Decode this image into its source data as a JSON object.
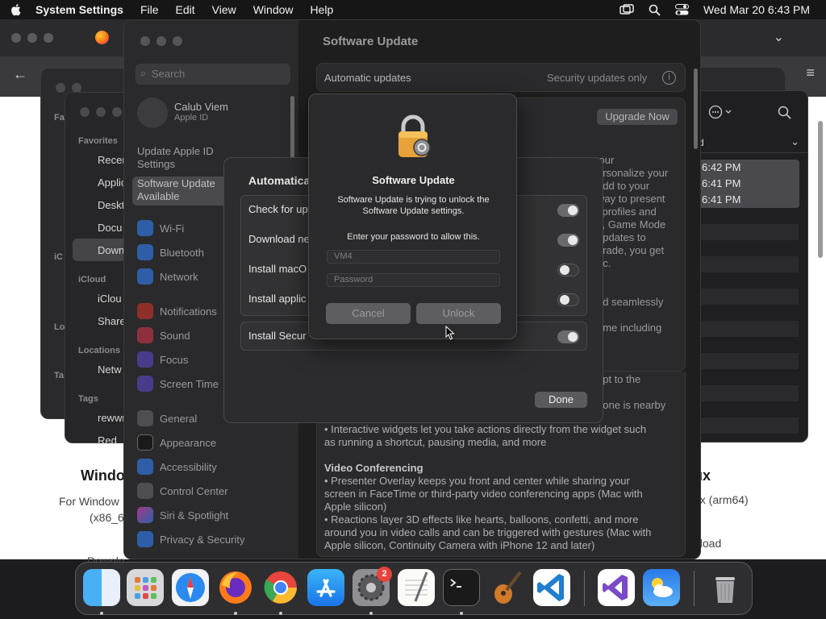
{
  "menubar": {
    "app_name": "System Settings",
    "menus": [
      "File",
      "Edit",
      "View",
      "Window",
      "Help"
    ],
    "clock": "Wed Mar 20  6:43 PM"
  },
  "browser": {
    "left_title": "Windo",
    "left_sub_1": "For Window",
    "left_sub_2": "(x86_6",
    "left_link": "Downlo",
    "right_title": "ux",
    "right_sub": "ux (arm64)",
    "right_link": "nload"
  },
  "finder": {
    "favorites_label": "Favorites",
    "icloud_label": "iCloud",
    "locations_label": "Locations",
    "tags_label": "Tags",
    "items": [
      "Recen",
      "Applic",
      "Deskt",
      "Docu",
      "Down",
      "iClou",
      "Share",
      "Netw",
      "rewwr",
      "Red"
    ],
    "clipped_labels": [
      "Fa",
      "iC",
      "Lo",
      "Ta"
    ]
  },
  "right_window": {
    "header_fragment": "d",
    "times": [
      "6:42 PM",
      "6:41 PM",
      "6:41 PM"
    ]
  },
  "settings": {
    "title": "Software Update",
    "search_placeholder": "Search",
    "user_name": "Calub Viem",
    "user_sub": "Apple ID",
    "update_apple_id_1": "Update Apple ID",
    "update_apple_id_2": "Settings",
    "selected_item_1": "Software Update",
    "selected_item_2": "Available",
    "sidebar_items": [
      "Wi-Fi",
      "Bluetooth",
      "Network",
      "Notifications",
      "Sound",
      "Focus",
      "Screen Time",
      "General",
      "Appearance",
      "Accessibility",
      "Control Center",
      "Siri & Spotlight",
      "Privacy & Security"
    ],
    "automatic_updates_label": "Automatic updates",
    "security_updates_label": "Security updates only",
    "upgrade_button": "Upgrade Now",
    "body_fragments": [
      "your",
      "ersonalize your",
      "add to your",
      "way to present",
      "i profiles and",
      "s, Game Mode",
      "updates to",
      "grade, you get",
      "ac.",
      "rld seamlessly",
      "eme including",
      "apt to the",
      "hone is nearby"
    ],
    "widgets_bullet_1": "• Interactive widgets let you take actions directly from the widget such",
    "widgets_bullet_2": "as running a shortcut, pausing media, and more",
    "video_heading": "Video Conferencing",
    "video_bullet_1": "• Presenter Overlay keeps you front and center while sharing your",
    "video_bullet_2": "screen in FaceTime or third-party video conferencing apps (Mac with",
    "video_bullet_3": "Apple silicon)",
    "video_bullet_4": "• Reactions layer 3D effects like hearts, balloons, confetti, and more",
    "video_bullet_5": "around you in video calls and can be triggered with gestures (Mac with",
    "video_bullet_6": "Apple silicon, Continuity Camera with iPhone 12 and later)"
  },
  "sheet": {
    "title": "Automatical",
    "rows": [
      {
        "label": "Check for up",
        "on": true
      },
      {
        "label": "Download ne",
        "on": true
      },
      {
        "label": "Install macO",
        "on": false
      },
      {
        "label": "Install applic",
        "on": false
      },
      {
        "label": "Install Secur",
        "on": true
      }
    ],
    "done_button": "Done"
  },
  "dialog": {
    "title": "Software Update",
    "message_1": "Software Update is trying to unlock the",
    "message_2": "Software Update settings.",
    "enter_prompt": "Enter your password to allow this.",
    "username_value": "VM4",
    "password_placeholder": "Password",
    "cancel_button": "Cancel",
    "unlock_button": "Unlock"
  },
  "dock": {
    "apps": [
      "Finder",
      "Launchpad",
      "Safari",
      "Firefox",
      "Google Chrome",
      "App Store",
      "System Settings",
      "TextEdit",
      "Terminal",
      "GarageBand",
      "Visual Studio Code",
      "Visual Studio",
      "Weather",
      "Trash"
    ],
    "settings_badge": "2"
  },
  "colors": {
    "dialog_bg": "#2a2a2c",
    "sheet_bg": "#2c2c2e",
    "toggle_on": "#6a6a6e",
    "badge_red": "#e8423a"
  }
}
